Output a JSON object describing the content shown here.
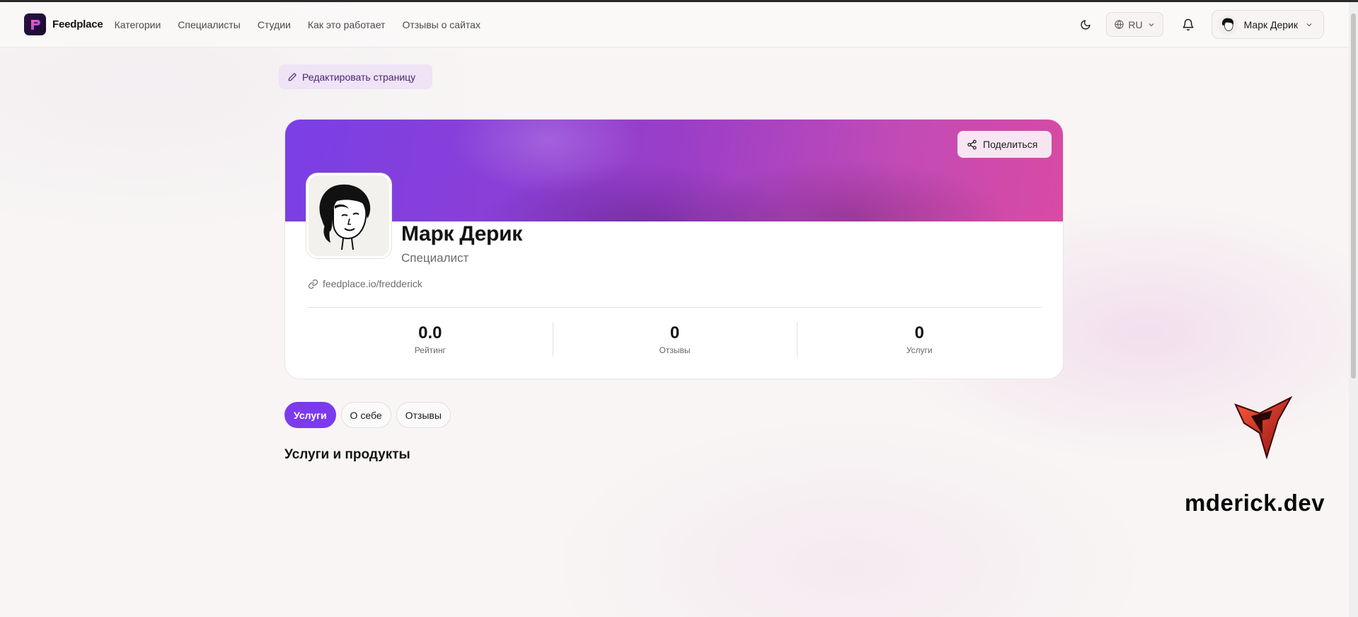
{
  "brand": {
    "name": "Feedplace"
  },
  "nav": {
    "items": [
      "Категории",
      "Специалисты",
      "Студии",
      "Как это работает",
      "Отзывы о сайтах"
    ]
  },
  "header": {
    "language": "RU",
    "user_name": "Марк Дерик"
  },
  "edit_button": {
    "label": "Редактировать страницу"
  },
  "profile": {
    "share_label": "Поделиться",
    "name": "Марк Дерик",
    "role": "Специалист",
    "link": "feedplace.io/fredderick",
    "stats": [
      {
        "value": "0.0",
        "label": "Рейтинг"
      },
      {
        "value": "0",
        "label": "Отзывы"
      },
      {
        "value": "0",
        "label": "Услуги"
      }
    ]
  },
  "tabs": [
    {
      "label": "Услуги",
      "active": true
    },
    {
      "label": "О себе",
      "active": false
    },
    {
      "label": "Отзывы",
      "active": false
    }
  ],
  "section": {
    "title": "Услуги и продукты"
  },
  "watermark": {
    "text": "mderick.dev"
  },
  "colors": {
    "accent": "#7c3aed",
    "banner_start": "#7a3fe6",
    "banner_end": "#d94aa3"
  },
  "icons": [
    "logo-icon",
    "moon-icon",
    "globe-icon",
    "chevron-down-icon",
    "bell-icon",
    "pencil-icon",
    "share-icon",
    "link-icon",
    "watermark-logo-icon"
  ]
}
